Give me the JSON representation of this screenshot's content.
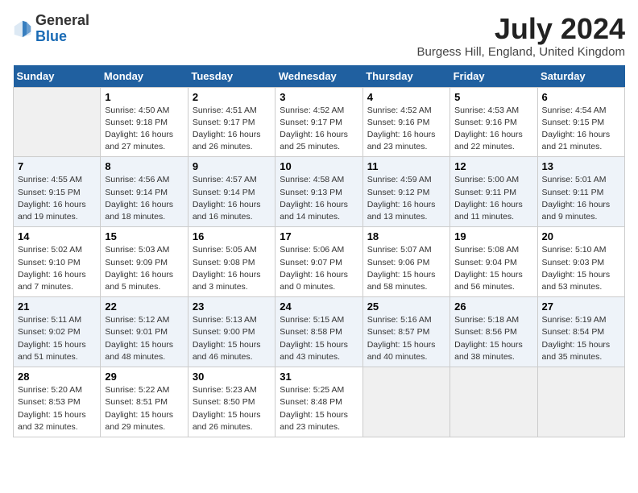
{
  "header": {
    "logo_general": "General",
    "logo_blue": "Blue",
    "month_title": "July 2024",
    "location": "Burgess Hill, England, United Kingdom"
  },
  "calendar": {
    "headers": [
      "Sunday",
      "Monday",
      "Tuesday",
      "Wednesday",
      "Thursday",
      "Friday",
      "Saturday"
    ],
    "weeks": [
      [
        {
          "day": "",
          "info": ""
        },
        {
          "day": "1",
          "info": "Sunrise: 4:50 AM\nSunset: 9:18 PM\nDaylight: 16 hours\nand 27 minutes."
        },
        {
          "day": "2",
          "info": "Sunrise: 4:51 AM\nSunset: 9:17 PM\nDaylight: 16 hours\nand 26 minutes."
        },
        {
          "day": "3",
          "info": "Sunrise: 4:52 AM\nSunset: 9:17 PM\nDaylight: 16 hours\nand 25 minutes."
        },
        {
          "day": "4",
          "info": "Sunrise: 4:52 AM\nSunset: 9:16 PM\nDaylight: 16 hours\nand 23 minutes."
        },
        {
          "day": "5",
          "info": "Sunrise: 4:53 AM\nSunset: 9:16 PM\nDaylight: 16 hours\nand 22 minutes."
        },
        {
          "day": "6",
          "info": "Sunrise: 4:54 AM\nSunset: 9:15 PM\nDaylight: 16 hours\nand 21 minutes."
        }
      ],
      [
        {
          "day": "7",
          "info": "Sunrise: 4:55 AM\nSunset: 9:15 PM\nDaylight: 16 hours\nand 19 minutes."
        },
        {
          "day": "8",
          "info": "Sunrise: 4:56 AM\nSunset: 9:14 PM\nDaylight: 16 hours\nand 18 minutes."
        },
        {
          "day": "9",
          "info": "Sunrise: 4:57 AM\nSunset: 9:14 PM\nDaylight: 16 hours\nand 16 minutes."
        },
        {
          "day": "10",
          "info": "Sunrise: 4:58 AM\nSunset: 9:13 PM\nDaylight: 16 hours\nand 14 minutes."
        },
        {
          "day": "11",
          "info": "Sunrise: 4:59 AM\nSunset: 9:12 PM\nDaylight: 16 hours\nand 13 minutes."
        },
        {
          "day": "12",
          "info": "Sunrise: 5:00 AM\nSunset: 9:11 PM\nDaylight: 16 hours\nand 11 minutes."
        },
        {
          "day": "13",
          "info": "Sunrise: 5:01 AM\nSunset: 9:11 PM\nDaylight: 16 hours\nand 9 minutes."
        }
      ],
      [
        {
          "day": "14",
          "info": "Sunrise: 5:02 AM\nSunset: 9:10 PM\nDaylight: 16 hours\nand 7 minutes."
        },
        {
          "day": "15",
          "info": "Sunrise: 5:03 AM\nSunset: 9:09 PM\nDaylight: 16 hours\nand 5 minutes."
        },
        {
          "day": "16",
          "info": "Sunrise: 5:05 AM\nSunset: 9:08 PM\nDaylight: 16 hours\nand 3 minutes."
        },
        {
          "day": "17",
          "info": "Sunrise: 5:06 AM\nSunset: 9:07 PM\nDaylight: 16 hours\nand 0 minutes."
        },
        {
          "day": "18",
          "info": "Sunrise: 5:07 AM\nSunset: 9:06 PM\nDaylight: 15 hours\nand 58 minutes."
        },
        {
          "day": "19",
          "info": "Sunrise: 5:08 AM\nSunset: 9:04 PM\nDaylight: 15 hours\nand 56 minutes."
        },
        {
          "day": "20",
          "info": "Sunrise: 5:10 AM\nSunset: 9:03 PM\nDaylight: 15 hours\nand 53 minutes."
        }
      ],
      [
        {
          "day": "21",
          "info": "Sunrise: 5:11 AM\nSunset: 9:02 PM\nDaylight: 15 hours\nand 51 minutes."
        },
        {
          "day": "22",
          "info": "Sunrise: 5:12 AM\nSunset: 9:01 PM\nDaylight: 15 hours\nand 48 minutes."
        },
        {
          "day": "23",
          "info": "Sunrise: 5:13 AM\nSunset: 9:00 PM\nDaylight: 15 hours\nand 46 minutes."
        },
        {
          "day": "24",
          "info": "Sunrise: 5:15 AM\nSunset: 8:58 PM\nDaylight: 15 hours\nand 43 minutes."
        },
        {
          "day": "25",
          "info": "Sunrise: 5:16 AM\nSunset: 8:57 PM\nDaylight: 15 hours\nand 40 minutes."
        },
        {
          "day": "26",
          "info": "Sunrise: 5:18 AM\nSunset: 8:56 PM\nDaylight: 15 hours\nand 38 minutes."
        },
        {
          "day": "27",
          "info": "Sunrise: 5:19 AM\nSunset: 8:54 PM\nDaylight: 15 hours\nand 35 minutes."
        }
      ],
      [
        {
          "day": "28",
          "info": "Sunrise: 5:20 AM\nSunset: 8:53 PM\nDaylight: 15 hours\nand 32 minutes."
        },
        {
          "day": "29",
          "info": "Sunrise: 5:22 AM\nSunset: 8:51 PM\nDaylight: 15 hours\nand 29 minutes."
        },
        {
          "day": "30",
          "info": "Sunrise: 5:23 AM\nSunset: 8:50 PM\nDaylight: 15 hours\nand 26 minutes."
        },
        {
          "day": "31",
          "info": "Sunrise: 5:25 AM\nSunset: 8:48 PM\nDaylight: 15 hours\nand 23 minutes."
        },
        {
          "day": "",
          "info": ""
        },
        {
          "day": "",
          "info": ""
        },
        {
          "day": "",
          "info": ""
        }
      ]
    ]
  }
}
